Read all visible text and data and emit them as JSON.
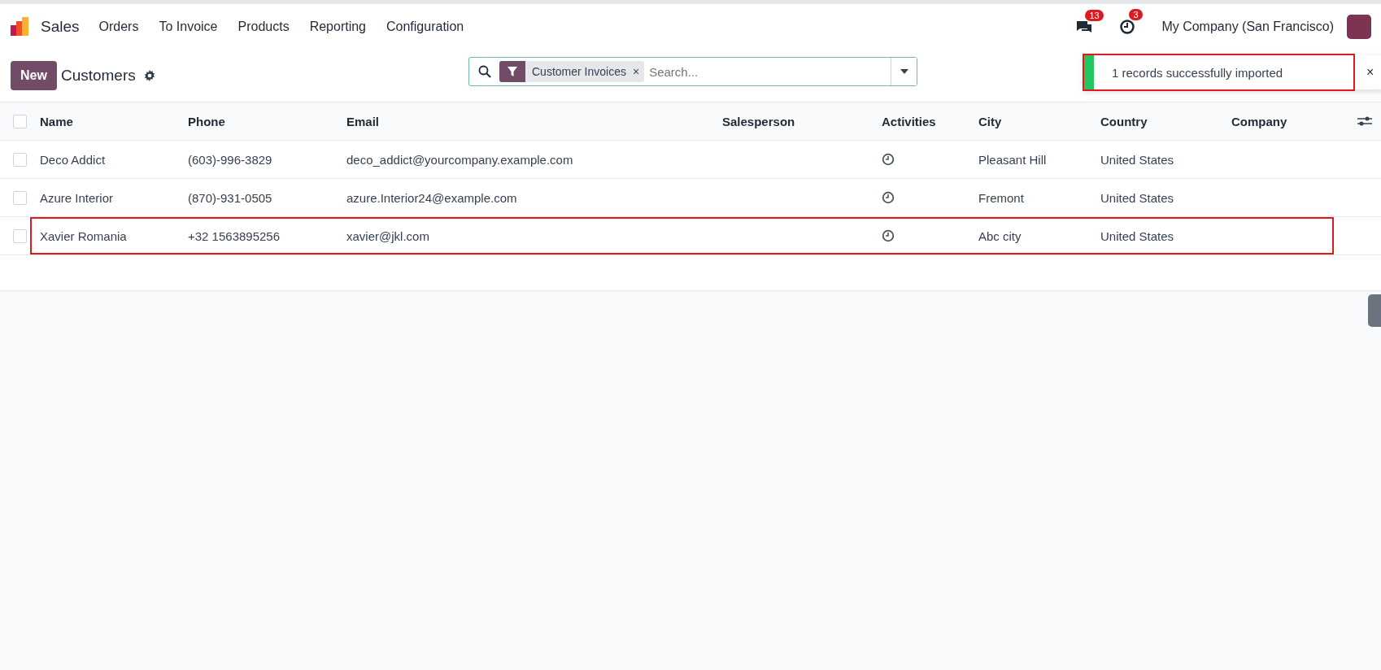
{
  "app": {
    "name": "Sales",
    "menu": [
      "Orders",
      "To Invoice",
      "Products",
      "Reporting",
      "Configuration"
    ]
  },
  "systray": {
    "messages_count": "13",
    "activities_count": "3",
    "company": "My Company (San Francisco)"
  },
  "control_panel": {
    "new_button": "New",
    "title": "Customers"
  },
  "search": {
    "facets": [
      {
        "label": "Customer Invoices",
        "remove": "×"
      }
    ],
    "placeholder": "Search..."
  },
  "toast": {
    "message": "1 records successfully imported",
    "close": "×",
    "highlighted": true
  },
  "table": {
    "all_selected": false,
    "columns": [
      "Name",
      "Phone",
      "Email",
      "Salesperson",
      "Activities",
      "City",
      "Country",
      "Company"
    ],
    "rows": [
      {
        "selected": false,
        "highlighted": false,
        "name": "Deco Addict",
        "phone": "(603)-996-3829",
        "email": "deco_addict@yourcompany.example.com",
        "city": "Pleasant Hill",
        "country": "United States"
      },
      {
        "selected": false,
        "highlighted": false,
        "name": "Azure Interior",
        "phone": "(870)-931-0505",
        "email": "azure.Interior24@example.com",
        "city": "Fremont",
        "country": "United States"
      },
      {
        "selected": false,
        "highlighted": true,
        "name": "Xavier Romania",
        "phone": "+32 1563895256",
        "email": "xavier@jkl.com",
        "city": "Abc city",
        "country": "United States"
      }
    ]
  }
}
